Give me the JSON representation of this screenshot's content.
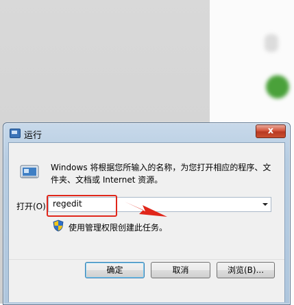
{
  "window": {
    "title": "运行",
    "close_label": "x"
  },
  "dialog": {
    "prompt": "Windows 将根据您所输入的名称，为您打开相应的程序、文件夹、文档或 Internet 资源。",
    "open_label": "打开(O):",
    "open_value": "regedit",
    "admin_note": "使用管理权限创建此任务。"
  },
  "buttons": {
    "ok": "确定",
    "cancel": "取消",
    "browse": "浏览(B)..."
  },
  "annotations": {
    "highlight_color": "#e0261a"
  },
  "icons": [
    "run-icon",
    "shield-icon",
    "dropdown-caret-icon",
    "close-icon",
    "window-icon"
  ]
}
